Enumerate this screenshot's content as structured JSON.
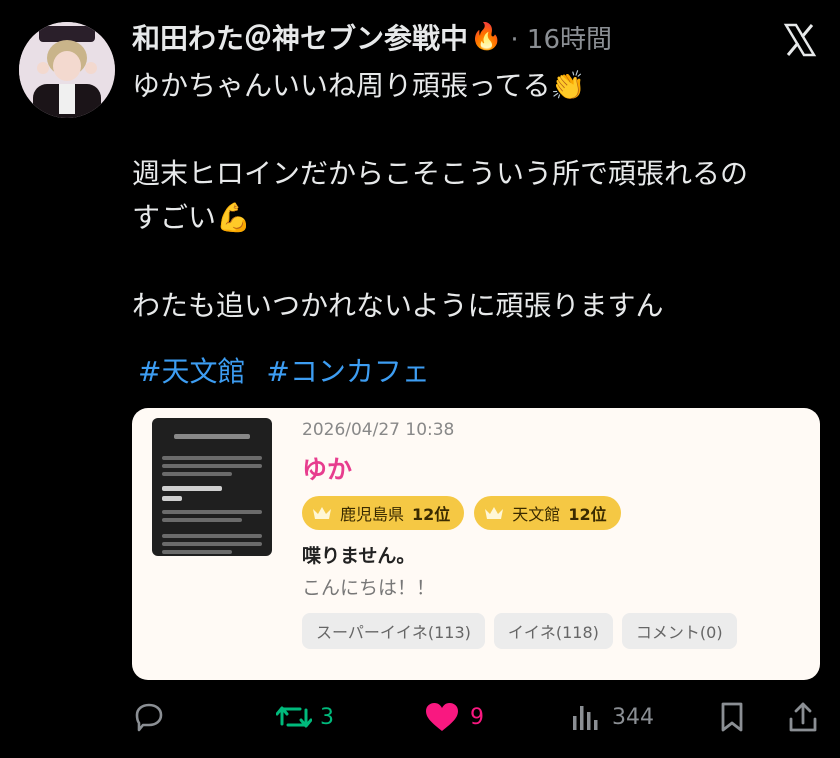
{
  "post": {
    "author_name": "和田わた＠神セブン参戦中",
    "author_emoji": "🔥",
    "meta": "· 16時間",
    "text_lines": [
      "ゆかちゃんいいね周り頑張ってる👏",
      "",
      "週末ヒロインだからこそこういう所で頑張れるの",
      "すごい💪",
      "",
      "わたも追いつかれないように頑張りますん"
    ],
    "hashtags": [
      "#天文館",
      "#コンカフェ"
    ]
  },
  "card": {
    "date": "2026/04/27 10:38",
    "name": "ゆか",
    "badges": [
      {
        "region": "鹿児島県",
        "rank": "12位"
      },
      {
        "region": "天文館",
        "rank": "12位"
      }
    ],
    "status": "喋りません。",
    "greeting": "こんにちは！！",
    "buttons": [
      "スーパーイイネ(113)",
      "イイネ(118)",
      "コメント(0)"
    ]
  },
  "actions": {
    "retweets": "3",
    "likes": "9",
    "views": "344"
  },
  "colors": {
    "retweet": "#00ba7c",
    "like": "#f91880",
    "hashtag": "#3d9df2",
    "card_name": "#e73d8e",
    "badge": "#f5c844"
  },
  "icons": [
    "x-logo-icon",
    "reply-icon",
    "retweet-icon",
    "heart-icon",
    "views-icon",
    "bookmark-icon",
    "share-icon",
    "crown-icon"
  ]
}
